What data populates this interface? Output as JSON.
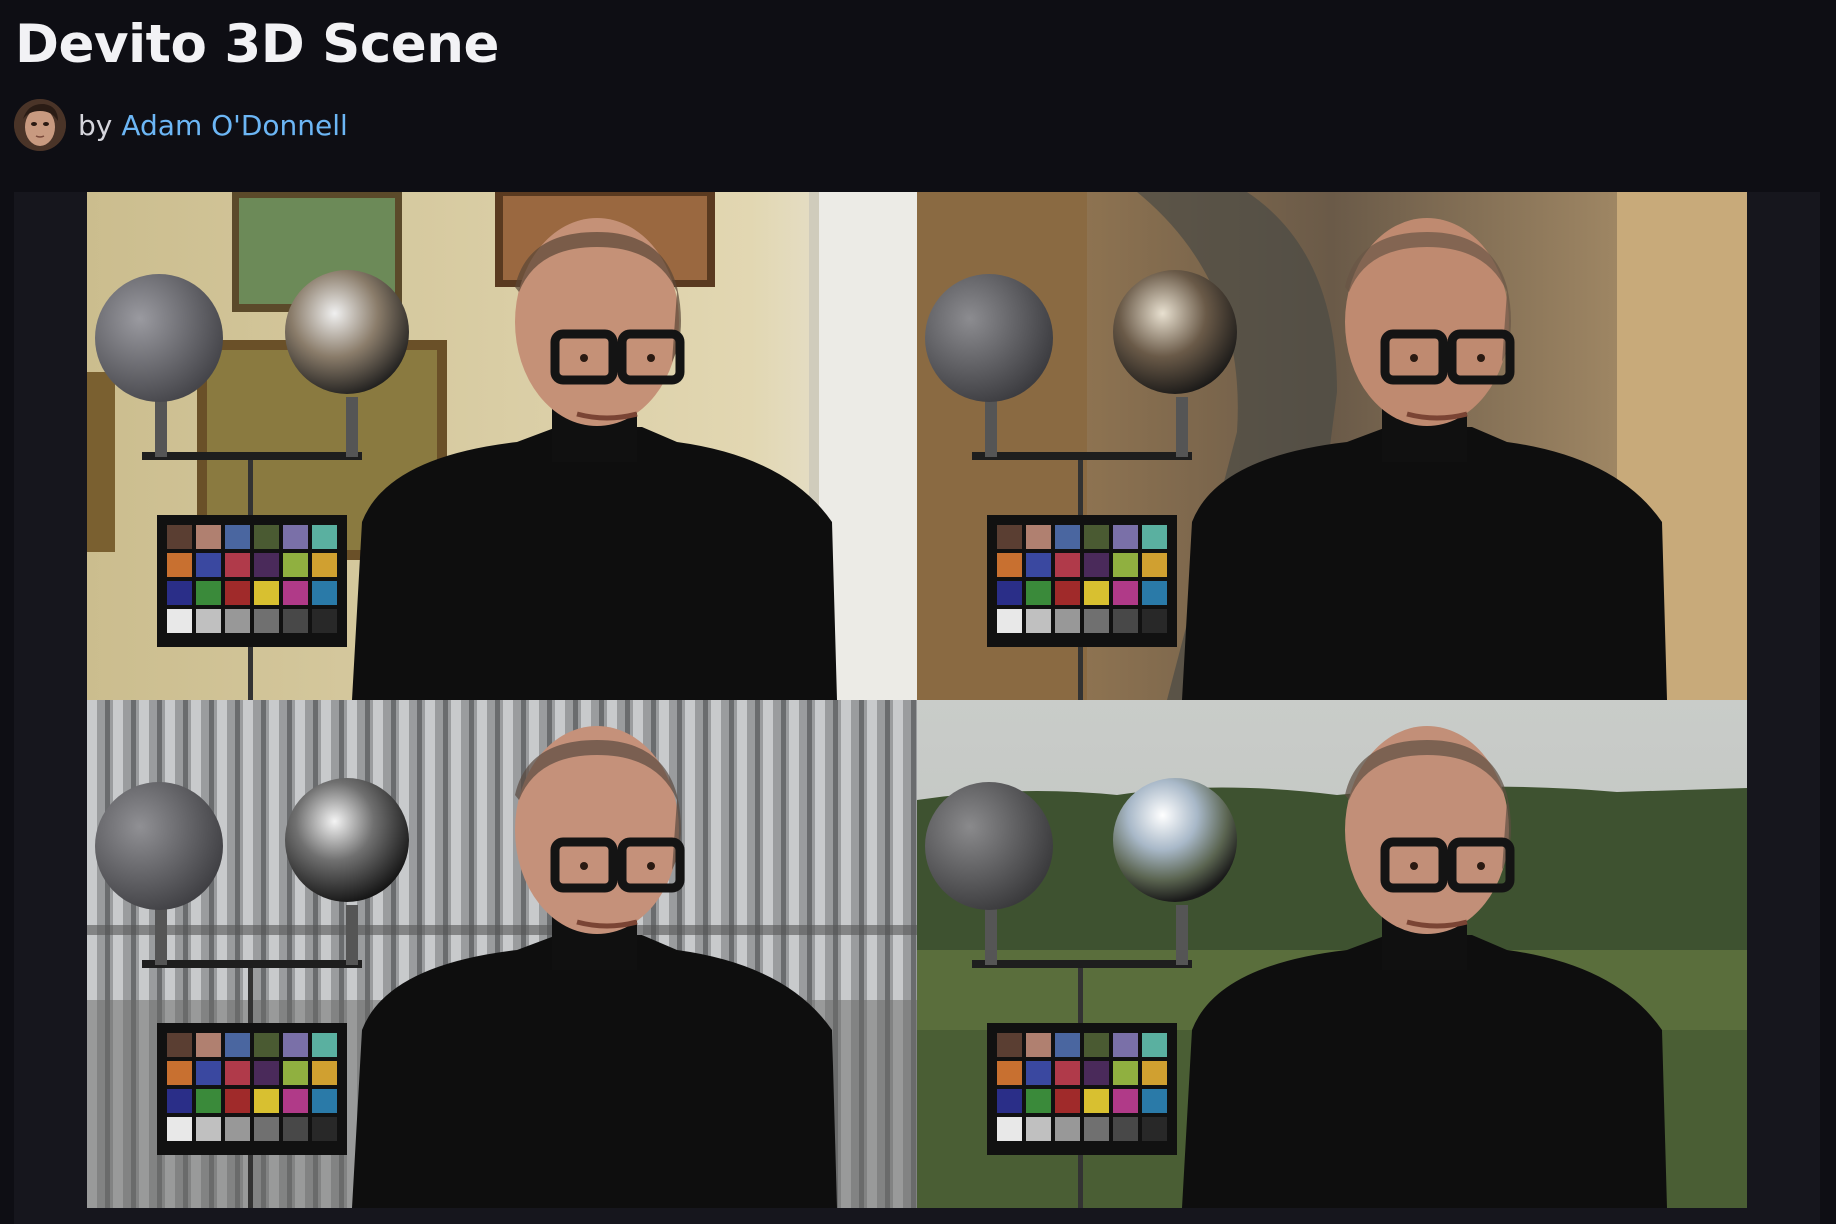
{
  "page": {
    "title": "Devito 3D Scene",
    "byline_prefix": "by",
    "author": "Adam O'Donnell"
  },
  "viewer": {
    "panels": [
      {
        "environment": "art-gallery"
      },
      {
        "environment": "industrial-ruins"
      },
      {
        "environment": "warehouse"
      },
      {
        "environment": "outdoor-field"
      }
    ]
  },
  "colors": {
    "background": "#0e0e14",
    "link": "#6cb6f5",
    "viewer_background": "#16161d"
  }
}
